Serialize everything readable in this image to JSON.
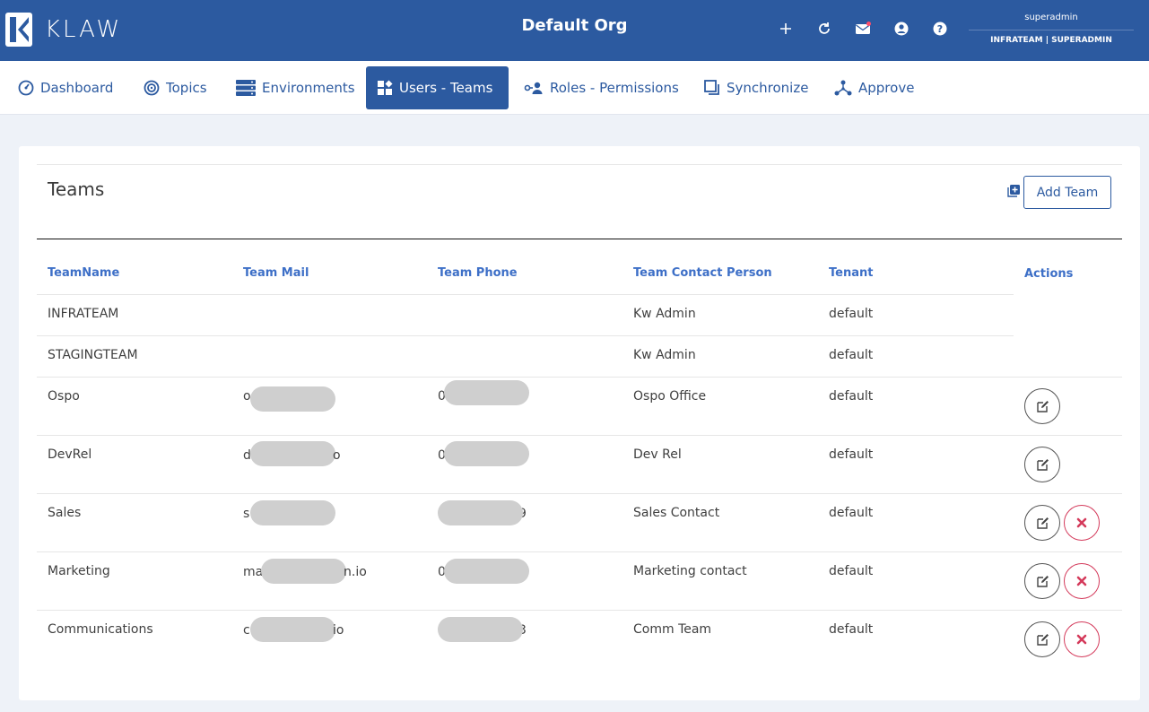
{
  "header": {
    "logo_text": "KLAW",
    "org_title": "Default Org",
    "icons": [
      "plus-icon",
      "refresh-icon",
      "mail-icon",
      "user-circle-icon",
      "help-icon"
    ],
    "user_name": "superadmin",
    "user_team_role": "INFRATEAM | SUPERADMIN",
    "colors": {
      "brand": "#2c5aa0",
      "notify_dot": "#ff4d6a"
    }
  },
  "nav": {
    "items": [
      {
        "label": "Dashboard",
        "icon": "gauge-icon",
        "active": false
      },
      {
        "label": "Topics",
        "icon": "target-icon",
        "active": false
      },
      {
        "label": "Environments",
        "icon": "server-icon",
        "active": false
      },
      {
        "label": "Users - Teams",
        "icon": "widgets-icon",
        "active": true
      },
      {
        "label": "Roles - Permissions",
        "icon": "users-key-icon",
        "active": false
      },
      {
        "label": "Synchronize",
        "icon": "copy-icon",
        "active": false
      },
      {
        "label": "Approve",
        "icon": "network-icon",
        "active": false
      }
    ]
  },
  "page": {
    "title": "Teams",
    "add_button": "Add Team"
  },
  "table": {
    "columns": [
      "TeamName",
      "Team Mail",
      "Team Phone",
      "Team Contact Person",
      "Tenant",
      "Actions"
    ],
    "rows": [
      {
        "name": "INFRATEAM",
        "mail_visible": "",
        "phone_visible": "",
        "contact": "Kw Admin",
        "tenant": "default",
        "edit": false,
        "delete": false
      },
      {
        "name": "STAGINGTEAM",
        "mail_visible": "",
        "phone_visible": "",
        "contact": "Kw Admin",
        "tenant": "default",
        "edit": false,
        "delete": false
      },
      {
        "name": "Ospo",
        "mail_visible": "o",
        "phone_visible": "0",
        "contact": "Ospo Office",
        "tenant": "default",
        "edit": true,
        "delete": false
      },
      {
        "name": "DevRel",
        "mail_visible": "d",
        "mail_suffix": "o",
        "phone_visible": "0",
        "contact": "Dev Rel",
        "tenant": "default",
        "edit": true,
        "delete": false
      },
      {
        "name": "Sales",
        "mail_visible": "s",
        "phone_visible": "",
        "phone_suffix": "9",
        "contact": "Sales Contact",
        "tenant": "default",
        "edit": true,
        "delete": true
      },
      {
        "name": "Marketing",
        "mail_visible": "ma",
        "mail_suffix": "n.io",
        "phone_visible": "0",
        "contact": "Marketing contact",
        "tenant": "default",
        "edit": true,
        "delete": true
      },
      {
        "name": "Communications",
        "mail_visible": "c",
        "mail_suffix": "io",
        "phone_visible": "",
        "phone_suffix": "3",
        "contact": "Comm Team",
        "tenant": "default",
        "edit": true,
        "delete": true
      }
    ],
    "colors": {
      "header": "#3d6fc7",
      "delete": "#d43a5b",
      "redaction": "#cfcfcf"
    }
  }
}
